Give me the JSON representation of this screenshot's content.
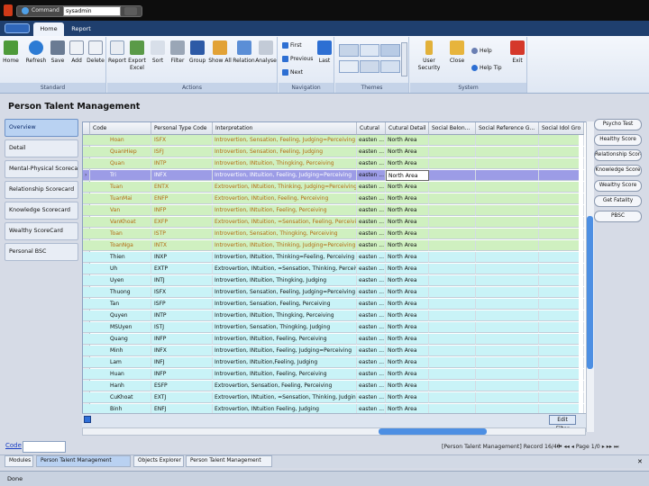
{
  "titlebar": {
    "command_label": "Command",
    "command_value": "sysadmin"
  },
  "ribbon": {
    "tabs": [
      "Home",
      "Report"
    ],
    "buttons": [
      "Home",
      "Refresh",
      "Save",
      "Add",
      "Delete",
      "Report",
      "Export",
      "Sort",
      "Filter",
      "Group",
      "Show All",
      "Relation",
      "Analyse",
      "Last",
      "User Security",
      "Close",
      "Exit"
    ],
    "export_sub": "Excel",
    "nav": [
      "First",
      "Previous",
      "Next"
    ],
    "help": [
      "Help",
      "Help Tip"
    ],
    "groups": [
      "Standard",
      "Actions",
      "Navigation",
      "Themes",
      "System"
    ]
  },
  "page": {
    "title": "Person Talent Management"
  },
  "left_nav": [
    "Overview",
    "Detail",
    "Mental-Physical Scorecard",
    "Relationship Scorecard",
    "Knowledge Scorecard",
    "Wealthy ScoreCard",
    "Personal BSC"
  ],
  "grid": {
    "columns": [
      "Code",
      "Personal Type Code",
      "Interpretation",
      "Cutural",
      "Cutural Detail",
      "Social Belon...",
      "Social Reference G...",
      "Social Idol Gro"
    ],
    "rows": [
      {
        "code": "Hoan",
        "type": "ISFX",
        "interp": "Introvertion, Sensation, Feeling, Judging=Perceiving",
        "cutural": "easten ...",
        "detail": "North Area",
        "style": "g"
      },
      {
        "code": "QuanHiep",
        "type": "ISFJ",
        "interp": "Introvertion, Sensation, Feeling, Judging",
        "cutural": "easten ...",
        "detail": "North Area",
        "style": "g"
      },
      {
        "code": "Quan",
        "type": "INTP",
        "interp": "Introvertion, INtuition, Thingking, Perceiving",
        "cutural": "easten ...",
        "detail": "North Area",
        "style": "g"
      },
      {
        "code": "Tri",
        "type": "INFX",
        "interp": "Introvertion, INtuition,  Feeling, Judging=Perceiving",
        "cutural": "easten ...",
        "detail": "North Area",
        "style": "sel"
      },
      {
        "code": "Tuan",
        "type": "ENTX",
        "interp": "Extrovertion, INtuition, Thinking, Judging=Perceiving",
        "cutural": "easten ...",
        "detail": "North Area",
        "style": "g"
      },
      {
        "code": "TuanMai",
        "type": "ENFP",
        "interp": "Extrovertion, INtuition, Feeling, Perceiving",
        "cutural": "easten ...",
        "detail": "North Area",
        "style": "g"
      },
      {
        "code": "Van",
        "type": "INFP",
        "interp": "Introvertion, INtuition, Feeling, Perceiving",
        "cutural": "easten ...",
        "detail": "North Area",
        "style": "g"
      },
      {
        "code": "VanKhoat",
        "type": "EXFP",
        "interp": "Extrovertion, INtuition, =Sensation,  Feeling, Perceiving",
        "cutural": "easten ...",
        "detail": "North Area",
        "style": "g"
      },
      {
        "code": "Toan",
        "type": "ISTP",
        "interp": "Introvertion, Sensation, Thingking, Perceiving",
        "cutural": "easten ...",
        "detail": "North Area",
        "style": "g"
      },
      {
        "code": "ToanNga",
        "type": "INTX",
        "interp": "Introvertion, INtuition,  Thinking, Judging=Perceiving",
        "cutural": "easten ...",
        "detail": "North Area",
        "style": "g"
      },
      {
        "code": "Thien",
        "type": "INXP",
        "interp": "Introvertion, INtuition, Thinking=Feeling, Perceiving",
        "cutural": "easten ...",
        "detail": "North Area",
        "style": "c"
      },
      {
        "code": "Uh",
        "type": "EXTP",
        "interp": "Extrovertion, INtuition, =Sensation, Thinking, Perceiving",
        "cutural": "easten ...",
        "detail": "North Area",
        "style": "c"
      },
      {
        "code": "Uyen",
        "type": "INTJ",
        "interp": "Introvertion, INtuition, Thingking, Judging",
        "cutural": "easten ...",
        "detail": "North Area",
        "style": "c"
      },
      {
        "code": "Thuong",
        "type": "ISFX",
        "interp": "Introvertion, Sensation, Feeling, Judging=Perceiving",
        "cutural": "easten ...",
        "detail": "North Area",
        "style": "c"
      },
      {
        "code": "Tan",
        "type": "ISFP",
        "interp": "Introvertion, Sensation, Feeling, Perceiving",
        "cutural": "easten ...",
        "detail": "North Area",
        "style": "c"
      },
      {
        "code": "Quyen",
        "type": "INTP",
        "interp": "Introvertion, INtuition, Thingking, Perceiving",
        "cutural": "easten ...",
        "detail": "North Area",
        "style": "c"
      },
      {
        "code": "MSUyen",
        "type": "ISTJ",
        "interp": "Introvertion, Sensation, Thingking, Judging",
        "cutural": "easten ...",
        "detail": "North Area",
        "style": "c"
      },
      {
        "code": "Quang",
        "type": "INFP",
        "interp": "Introvertion, INtuition, Feeling, Perceiving",
        "cutural": "easten ...",
        "detail": "North Area",
        "style": "c"
      },
      {
        "code": "Minh",
        "type": "INFX",
        "interp": "Introvertion, INtuition,  Feeling, Judging=Perceiving",
        "cutural": "easten ...",
        "detail": "North Area",
        "style": "c"
      },
      {
        "code": "Lam",
        "type": "INFJ",
        "interp": "Introvertion, INtuition,Feeling, Judging",
        "cutural": "easten ...",
        "detail": "North Area",
        "style": "c"
      },
      {
        "code": "Huan",
        "type": "INFP",
        "interp": "Introvertion, INtuition, Feeling, Perceiving",
        "cutural": "easten ...",
        "detail": "North Area",
        "style": "c"
      },
      {
        "code": "Hanh",
        "type": "ESFP",
        "interp": "Extrovertion, Sensation, Feeling, Perceiving",
        "cutural": "easten ...",
        "detail": "North Area",
        "style": "c"
      },
      {
        "code": "CuKhoat",
        "type": "EXTJ",
        "interp": "Extrovertion, INtuition, =Sensation, Thinking, Judging",
        "cutural": "easten ...",
        "detail": "North Area",
        "style": "c"
      },
      {
        "code": "Binh",
        "type": "ENFJ",
        "interp": "Extrovertion, INtuition Feeling, Judging",
        "cutural": "easten ...",
        "detail": "North Area",
        "style": "c"
      }
    ],
    "edit_filter": "Edit Filter"
  },
  "right_buttons": [
    "Psycho Test",
    "Healthy Score",
    "Relationship Score",
    "Knowledge Score",
    "Wealthy Score",
    "Get Fatality",
    "PBSC"
  ],
  "footer": {
    "code_label": "Code",
    "record_text": "[Person Talent Management] Record 16/40",
    "page_text": "Page 1/0",
    "tabs": [
      "Modules",
      "Person Talent Management",
      "Objects Explorer",
      "Person Talent Management"
    ],
    "status": "Done"
  },
  "colors": {
    "green_row": "#cff0c0",
    "cyan_row": "#c9f3f7",
    "selected_row": "#9c9ce6",
    "scroll_thumb": "#4d8fe3"
  }
}
